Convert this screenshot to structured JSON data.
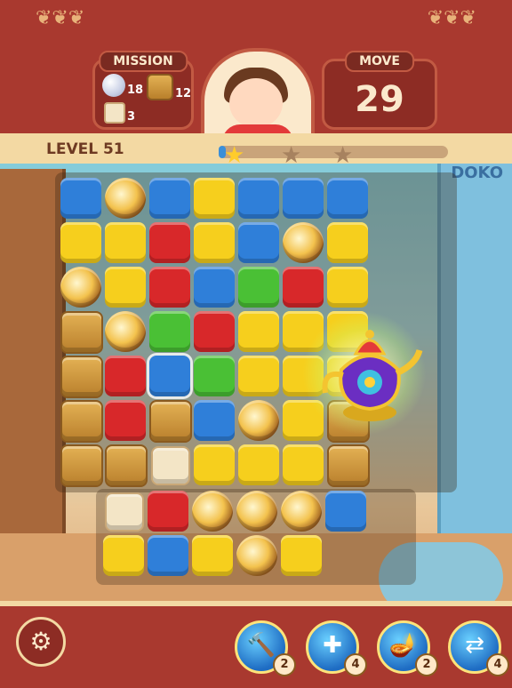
{
  "mission": {
    "title": "MISSION",
    "goals": [
      {
        "icon": "bubble-icon",
        "count": "18"
      },
      {
        "icon": "crate-icon",
        "count": "12"
      },
      {
        "icon": "cup-icon",
        "count": "3"
      }
    ]
  },
  "move": {
    "title": "MOVE",
    "value": "29"
  },
  "level": {
    "label": "LEVEL 51",
    "progress": 0.03,
    "stars_earned": 1,
    "stars_total": 3
  },
  "background": {
    "sign": "DOKO"
  },
  "boosters": [
    {
      "name": "hammer-booster",
      "icon": "hammer-icon",
      "count": "2"
    },
    {
      "name": "cross-blast-booster",
      "icon": "cross-arrows-icon",
      "count": "4"
    },
    {
      "name": "magic-lamp-booster",
      "icon": "lamp-icon",
      "count": "2"
    },
    {
      "name": "shuffle-booster",
      "icon": "shuffle-icon",
      "count": "4"
    }
  ],
  "colors": {
    "panel": "#a9392f",
    "accent": "#f3d9a3",
    "yellow_block": "#f6cf1d",
    "blue_block": "#2f7fd9",
    "red_block": "#d8282a",
    "green_block": "#4ac035"
  }
}
